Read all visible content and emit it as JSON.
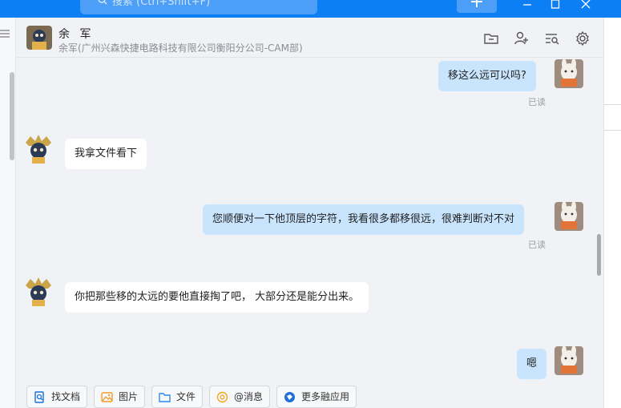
{
  "search": {
    "placeholder": "搜索 (Ctrl+Shift+F)"
  },
  "window": {
    "plus_icon": "plus-icon",
    "minimize_icon": "minimize-icon",
    "maximize_icon": "maximize-icon",
    "close_icon": "close-icon"
  },
  "header": {
    "name": "余 军",
    "subtitle": "余军(广州兴森快捷电路科技有限公司衡阳分公司-CAM部)"
  },
  "messages": [
    {
      "side": "out",
      "text": "移这么远可以吗?",
      "status": "已读"
    },
    {
      "side": "in",
      "text": "我拿文件看下"
    },
    {
      "side": "out",
      "text": "您顺便对一下他顶层的字符，我看很多都移很远，很难判断对不对",
      "status": "已读"
    },
    {
      "side": "in",
      "text": "你把那些移的太远的要他直接掏了吧， 大部分还是能分出来。"
    },
    {
      "side": "out",
      "text": "嗯"
    }
  ],
  "toolbar": {
    "find_doc": "找文档",
    "image": "图片",
    "file": "文件",
    "mention": "@消息",
    "more_apps": "更多融应用"
  },
  "colors": {
    "accent": "#0d7ff5",
    "outgoing_bubble": "#c9e5fe",
    "incoming_bubble": "#ffffff",
    "background": "#f1f2f5"
  }
}
